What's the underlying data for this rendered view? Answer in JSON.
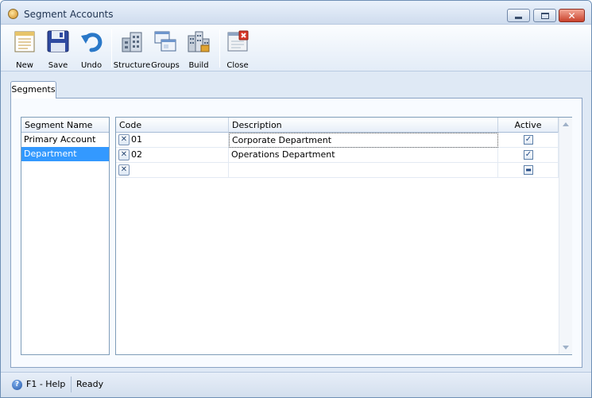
{
  "window": {
    "title": "Segment Accounts"
  },
  "toolbar": {
    "new_label": "New",
    "save_label": "Save",
    "undo_label": "Undo",
    "structure_label": "Structure",
    "groups_label": "Groups",
    "build_label": "Build",
    "close_label": "Close"
  },
  "tabs": [
    {
      "label": "Segments"
    }
  ],
  "segment_list": {
    "header": "Segment Name",
    "items": [
      {
        "label": "Primary Account",
        "selected": false
      },
      {
        "label": "Department",
        "selected": true
      }
    ]
  },
  "grid": {
    "columns": [
      "Code",
      "Description",
      "Active"
    ],
    "rows": [
      {
        "code": "01",
        "description": "Corporate Department",
        "active": true
      },
      {
        "code": "02",
        "description": "Operations Department",
        "active": true
      },
      {
        "code": "",
        "description": "",
        "active": null
      }
    ]
  },
  "statusbar": {
    "help": "F1 - Help",
    "status": "Ready"
  },
  "colors": {
    "selection": "#3399ff",
    "frame": "#dfe9f5",
    "border": "#7f9db9"
  }
}
